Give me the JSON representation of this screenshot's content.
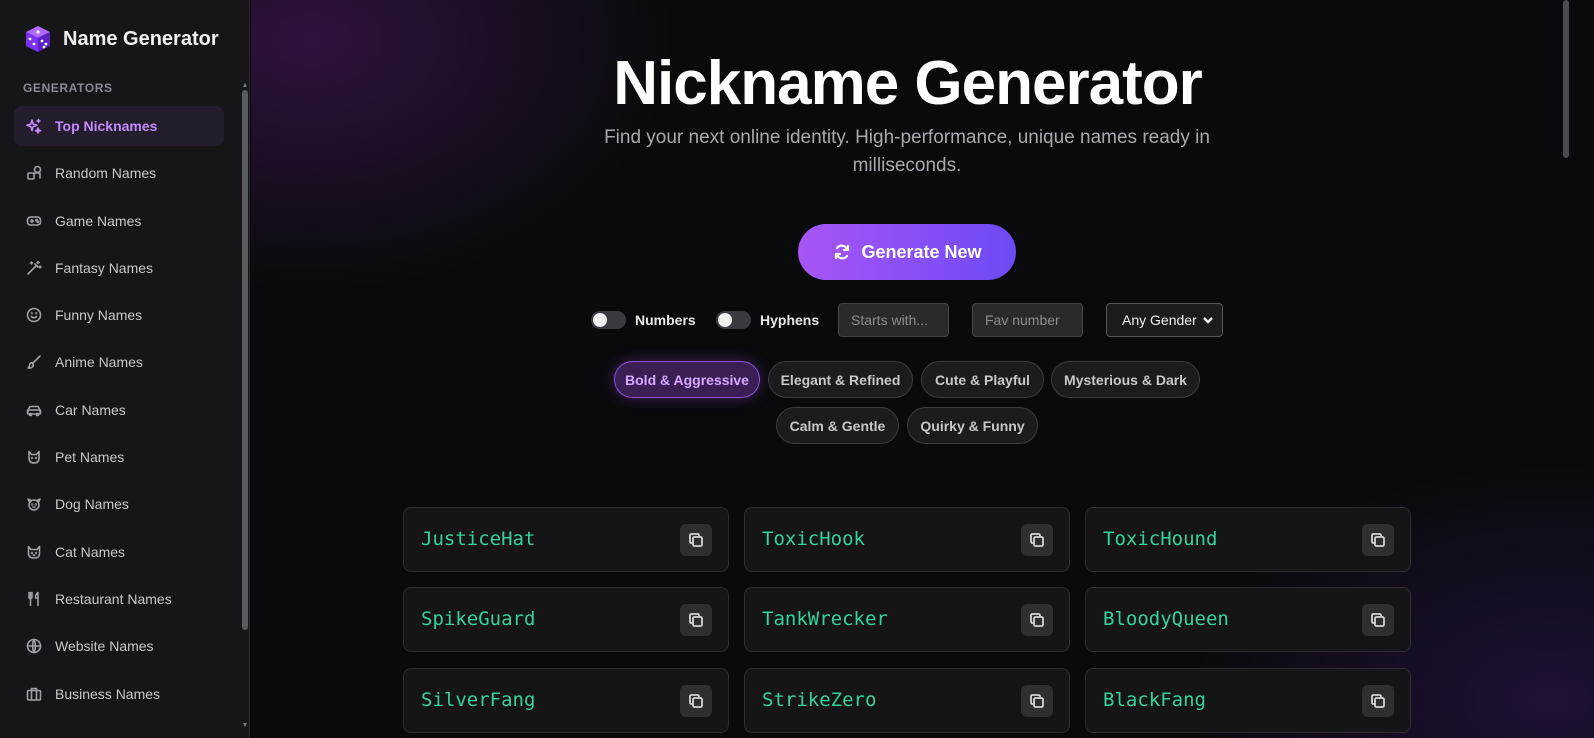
{
  "brand": {
    "title": "Name Generator",
    "icon": "dice-icon"
  },
  "sidebar": {
    "section_label": "GENERATORS",
    "items": [
      {
        "label": "Top Nicknames",
        "icon": "sparkles-icon",
        "active": true
      },
      {
        "label": "Random Names",
        "icon": "shapes-icon"
      },
      {
        "label": "Game Names",
        "icon": "gamepad-icon"
      },
      {
        "label": "Fantasy Names",
        "icon": "wand-icon"
      },
      {
        "label": "Funny Names",
        "icon": "smile-icon"
      },
      {
        "label": "Anime Names",
        "icon": "brush-icon"
      },
      {
        "label": "Car Names",
        "icon": "car-icon"
      },
      {
        "label": "Pet Names",
        "icon": "pet-icon"
      },
      {
        "label": "Dog Names",
        "icon": "dog-icon"
      },
      {
        "label": "Cat Names",
        "icon": "cat-icon"
      },
      {
        "label": "Restaurant Names",
        "icon": "utensils-icon"
      },
      {
        "label": "Website Names",
        "icon": "globe-icon"
      },
      {
        "label": "Business Names",
        "icon": "briefcase-icon"
      }
    ]
  },
  "main": {
    "title": "Nickname Generator",
    "subtitle": "Find your next online identity. High-performance, unique names ready in milliseconds.",
    "generate_label": "Generate New",
    "toggles": [
      {
        "label": "Numbers",
        "on": false
      },
      {
        "label": "Hyphens",
        "on": false
      }
    ],
    "inputs": {
      "starts_with": {
        "placeholder": "Starts with...",
        "value": ""
      },
      "fav_number": {
        "placeholder": "Fav number",
        "value": ""
      }
    },
    "gender_select": {
      "value": "Any Gender"
    },
    "styles": [
      {
        "label": "Bold & Aggressive",
        "active": true
      },
      {
        "label": "Elegant & Refined"
      },
      {
        "label": "Cute & Playful"
      },
      {
        "label": "Mysterious & Dark"
      },
      {
        "label": "Calm & Gentle"
      },
      {
        "label": "Quirky & Funny"
      }
    ],
    "names": [
      "JusticeHat",
      "ToxicHook",
      "ToxicHound",
      "SpikeGuard",
      "TankWrecker",
      "BloodyQueen",
      "SilverFang",
      "StrikeZero",
      "BlackFang"
    ]
  },
  "colors": {
    "accent": "#a855f7",
    "name_text": "#34d399",
    "active_nav": "#c58af9"
  }
}
